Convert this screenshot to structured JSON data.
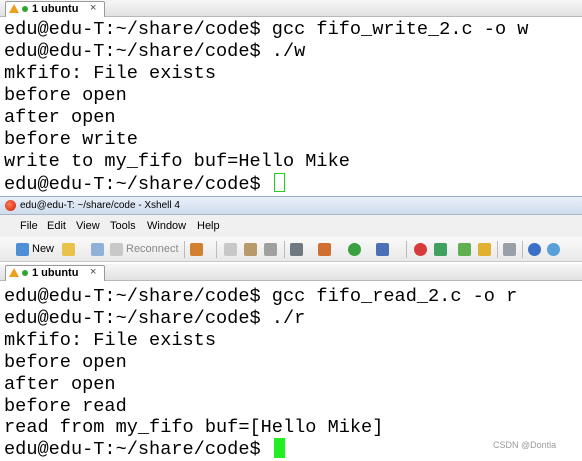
{
  "top_window": {
    "tab_label": "1 ubuntu",
    "tab_close": "×",
    "lines": [
      "edu@edu-T:~/share/code$ gcc fifo_write_2.c -o w",
      "edu@edu-T:~/share/code$ ./w",
      "mkfifo: File exists",
      "before open",
      "after open",
      "before write",
      "write to my_fifo buf=Hello Mike",
      "edu@edu-T:~/share/code$ "
    ]
  },
  "bottom_window": {
    "title": "edu@edu-T: ~/share/code - Xshell 4",
    "menu": [
      "File",
      "Edit",
      "View",
      "Tools",
      "Window",
      "Help"
    ],
    "toolbar": {
      "new_label": "New",
      "reconnect_label": "Reconnect",
      "icons": [
        "new-session-icon",
        "open-folder-icon",
        "link-icon",
        "reconnect-icon",
        "properties-icon",
        "copy-icon",
        "paste-icon",
        "find-icon",
        "print-icon",
        "transfer-icon",
        "globe-icon",
        "font-icon",
        "xftp-icon",
        "script-icon",
        "layout-icon",
        "lock-icon",
        "keyboard-icon",
        "help-icon",
        "chat-icon"
      ]
    },
    "tab_label": "1 ubuntu",
    "tab_close": "×",
    "lines": [
      "edu@edu-T:~/share/code$ gcc fifo_read_2.c -o r",
      "edu@edu-T:~/share/code$ ./r",
      "mkfifo: File exists",
      "before open",
      "after open",
      "before read",
      "read from my_fifo buf=[Hello Mike]",
      "edu@edu-T:~/share/code$ "
    ]
  },
  "watermark": "CSDN @Dontla",
  "colors": {
    "cursor": "#22ee22",
    "warning": "#f0a020",
    "status_dot": "#2fa52f"
  }
}
